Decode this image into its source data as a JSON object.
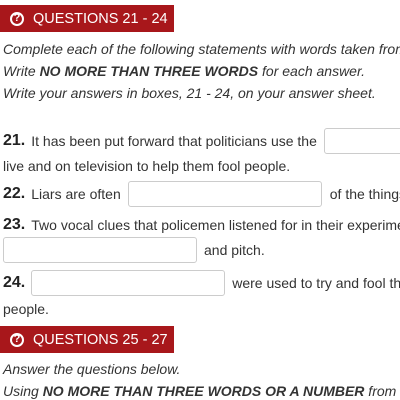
{
  "section1": {
    "header": "QUESTIONS 21 - 24",
    "instructions": {
      "line1": "Complete each of the following statements with words taken from",
      "line2_pre": "Write ",
      "line2_bold": "NO MORE THAN THREE WORDS",
      "line2_post": " for each answer.",
      "line3": "Write your answers in boxes, 21 - 24, on your answer sheet."
    },
    "questions": [
      {
        "number": "21.",
        "text_before": "It has been put forward that politicians use the",
        "text_continued": "live and on television to help them fool people.",
        "answer": ""
      },
      {
        "number": "22.",
        "text_before": "Liars are often",
        "text_after": "of the things",
        "answer": ""
      },
      {
        "number": "23.",
        "text_before": "Two vocal clues that policemen listened for in their experime",
        "text_after": "and pitch.",
        "answer": ""
      },
      {
        "number": "24.",
        "text_after": "were used to try and fool th",
        "text_continued": "people.",
        "answer": ""
      }
    ]
  },
  "section2": {
    "header": "QUESTIONS 25 - 27",
    "instructions": {
      "line1": "Answer the questions below.",
      "line2_pre": "Using ",
      "line2_bold": "NO MORE THAN THREE WORDS OR A NUMBER",
      "line2_post": " from P"
    }
  },
  "icons": {
    "header_icon": "question-circle-icon"
  },
  "colors": {
    "header_background": "#a8171b",
    "header_text": "#ffffff",
    "body_text": "#333333"
  }
}
